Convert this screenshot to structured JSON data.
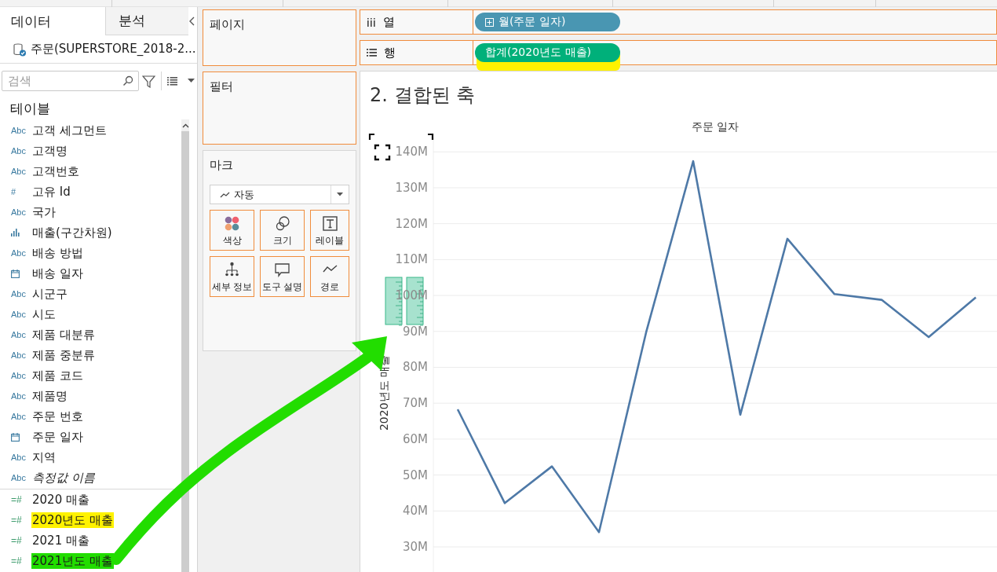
{
  "data_pane": {
    "tabs": [
      {
        "label": "데이터",
        "selected": true
      },
      {
        "label": "분석",
        "selected": false
      }
    ],
    "datasource": "주문(SUPERSTORE_2018-2...",
    "search": {
      "placeholder": "검색"
    },
    "section": "테이블",
    "fields": [
      {
        "label": "고객 세그먼트",
        "kind": "text",
        "glyph": "Abc"
      },
      {
        "label": "고객명",
        "kind": "text",
        "glyph": "Abc"
      },
      {
        "label": "고객번호",
        "kind": "text",
        "glyph": "Abc"
      },
      {
        "label": "고유 Id",
        "kind": "number",
        "glyph": "#"
      },
      {
        "label": "국가",
        "kind": "text",
        "glyph": "Abc"
      },
      {
        "label": "매출(구간차원)",
        "kind": "bin"
      },
      {
        "label": "배송 방법",
        "kind": "text",
        "glyph": "Abc"
      },
      {
        "label": "배송 일자",
        "kind": "date"
      },
      {
        "label": "시군구",
        "kind": "text",
        "glyph": "Abc"
      },
      {
        "label": "시도",
        "kind": "text",
        "glyph": "Abc"
      },
      {
        "label": "제품 대분류",
        "kind": "text",
        "glyph": "Abc"
      },
      {
        "label": "제품 중분류",
        "kind": "text",
        "glyph": "Abc"
      },
      {
        "label": "제품 코드",
        "kind": "text",
        "glyph": "Abc"
      },
      {
        "label": "제품명",
        "kind": "text",
        "glyph": "Abc"
      },
      {
        "label": "주문 번호",
        "kind": "text",
        "glyph": "Abc"
      },
      {
        "label": "주문 일자",
        "kind": "date"
      },
      {
        "label": "지역",
        "kind": "text",
        "glyph": "Abc"
      },
      {
        "label": "측정값 이름",
        "kind": "names",
        "glyph": "Abc"
      },
      {
        "label": "2020 매출",
        "kind": "measure",
        "glyph": "=#"
      },
      {
        "label": "2020년도 매출",
        "kind": "measure",
        "glyph": "=#",
        "color": "#fff200"
      },
      {
        "label": "2021 매출",
        "kind": "measure",
        "glyph": "=#"
      },
      {
        "label": "2021년도 매출",
        "kind": "measure",
        "glyph": "=#",
        "color": "#22dd00"
      }
    ]
  },
  "pages_shelf": {
    "title": "페이지"
  },
  "filters_shelf": {
    "title": "필터"
  },
  "marks": {
    "title": "마크",
    "type": "자동",
    "buttons": [
      {
        "label": "색상",
        "kind": "color"
      },
      {
        "label": "크기",
        "kind": "size"
      },
      {
        "label": "레이블",
        "kind": "label"
      },
      {
        "label": "세부 정보",
        "kind": "detail"
      },
      {
        "label": "도구 설명",
        "kind": "tooltip"
      },
      {
        "label": "경로",
        "kind": "path"
      }
    ]
  },
  "columns_shelf": {
    "label": "열",
    "kind": "columns",
    "pills": [
      {
        "label": "월(주문 일자)",
        "kind": "dimension",
        "highlighted": false
      }
    ]
  },
  "rows_shelf": {
    "label": "행",
    "kind": "rows",
    "pills": [
      {
        "label": "합계(2020년도 매출)",
        "kind": "measure",
        "highlighted": true
      }
    ]
  },
  "view": {
    "title": "2. 결합된 축",
    "chart_data": {
      "type": "line",
      "grid": true,
      "xlabel": "주문 일자",
      "ylabel": "2020년도 매출",
      "ylim": [
        23,
        144
      ],
      "yticks": [
        {
          "value": 30,
          "label": "30M"
        },
        {
          "value": 40,
          "label": "40M"
        },
        {
          "value": 50,
          "label": "50M"
        },
        {
          "value": 60,
          "label": "60M"
        },
        {
          "value": 70,
          "label": "70M"
        },
        {
          "value": 80,
          "label": "80M"
        },
        {
          "value": 90,
          "label": "90M"
        },
        {
          "value": 100,
          "label": "100M"
        },
        {
          "value": 110,
          "label": "110M"
        },
        {
          "value": 120,
          "label": "120M"
        },
        {
          "value": 130,
          "label": "130M"
        },
        {
          "value": 140,
          "label": "140M"
        }
      ],
      "series": [
        {
          "color": "#4e79a7",
          "values": [
            68.3,
            42.2,
            52.4,
            34.1,
            89.7,
            137.4,
            66.8,
            115.8,
            100.4,
            98.8,
            88.4,
            99.5
          ]
        }
      ]
    }
  }
}
